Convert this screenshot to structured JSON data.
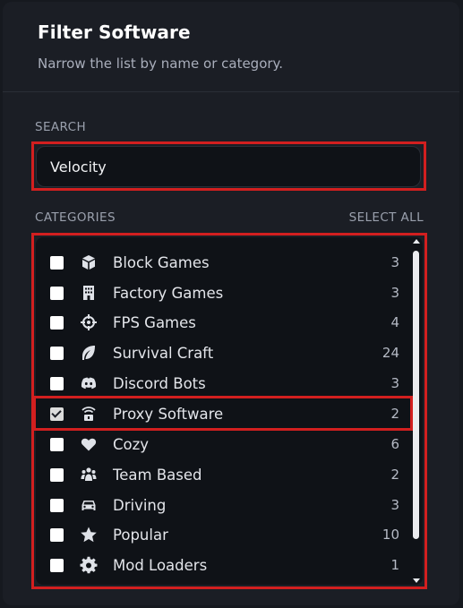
{
  "header": {
    "title": "Filter Software",
    "subtitle": "Narrow the list by name or category."
  },
  "search": {
    "label": "SEARCH",
    "value": "Velocity"
  },
  "categories": {
    "label": "CATEGORIES",
    "select_all": "SELECT ALL",
    "items": [
      {
        "label": "Block Games",
        "count": "3",
        "icon": "cube-icon",
        "checked": false
      },
      {
        "label": "Factory Games",
        "count": "3",
        "icon": "building-icon",
        "checked": false
      },
      {
        "label": "FPS Games",
        "count": "4",
        "icon": "crosshair-icon",
        "checked": false
      },
      {
        "label": "Survival Craft",
        "count": "24",
        "icon": "leaf-icon",
        "checked": false
      },
      {
        "label": "Discord Bots",
        "count": "3",
        "icon": "discord-icon",
        "checked": false
      },
      {
        "label": "Proxy Software",
        "count": "2",
        "icon": "proxy-lock-icon",
        "checked": true
      },
      {
        "label": "Cozy",
        "count": "6",
        "icon": "heart-icon",
        "checked": false
      },
      {
        "label": "Team Based",
        "count": "2",
        "icon": "users-icon",
        "checked": false
      },
      {
        "label": "Driving",
        "count": "3",
        "icon": "car-icon",
        "checked": false
      },
      {
        "label": "Popular",
        "count": "10",
        "icon": "star-icon",
        "checked": false
      },
      {
        "label": "Mod Loaders",
        "count": "1",
        "icon": "gear-icon",
        "checked": false
      }
    ]
  },
  "colors": {
    "highlight": "#d21f1f",
    "background": "#1b1e25",
    "field": "#0f1217"
  }
}
